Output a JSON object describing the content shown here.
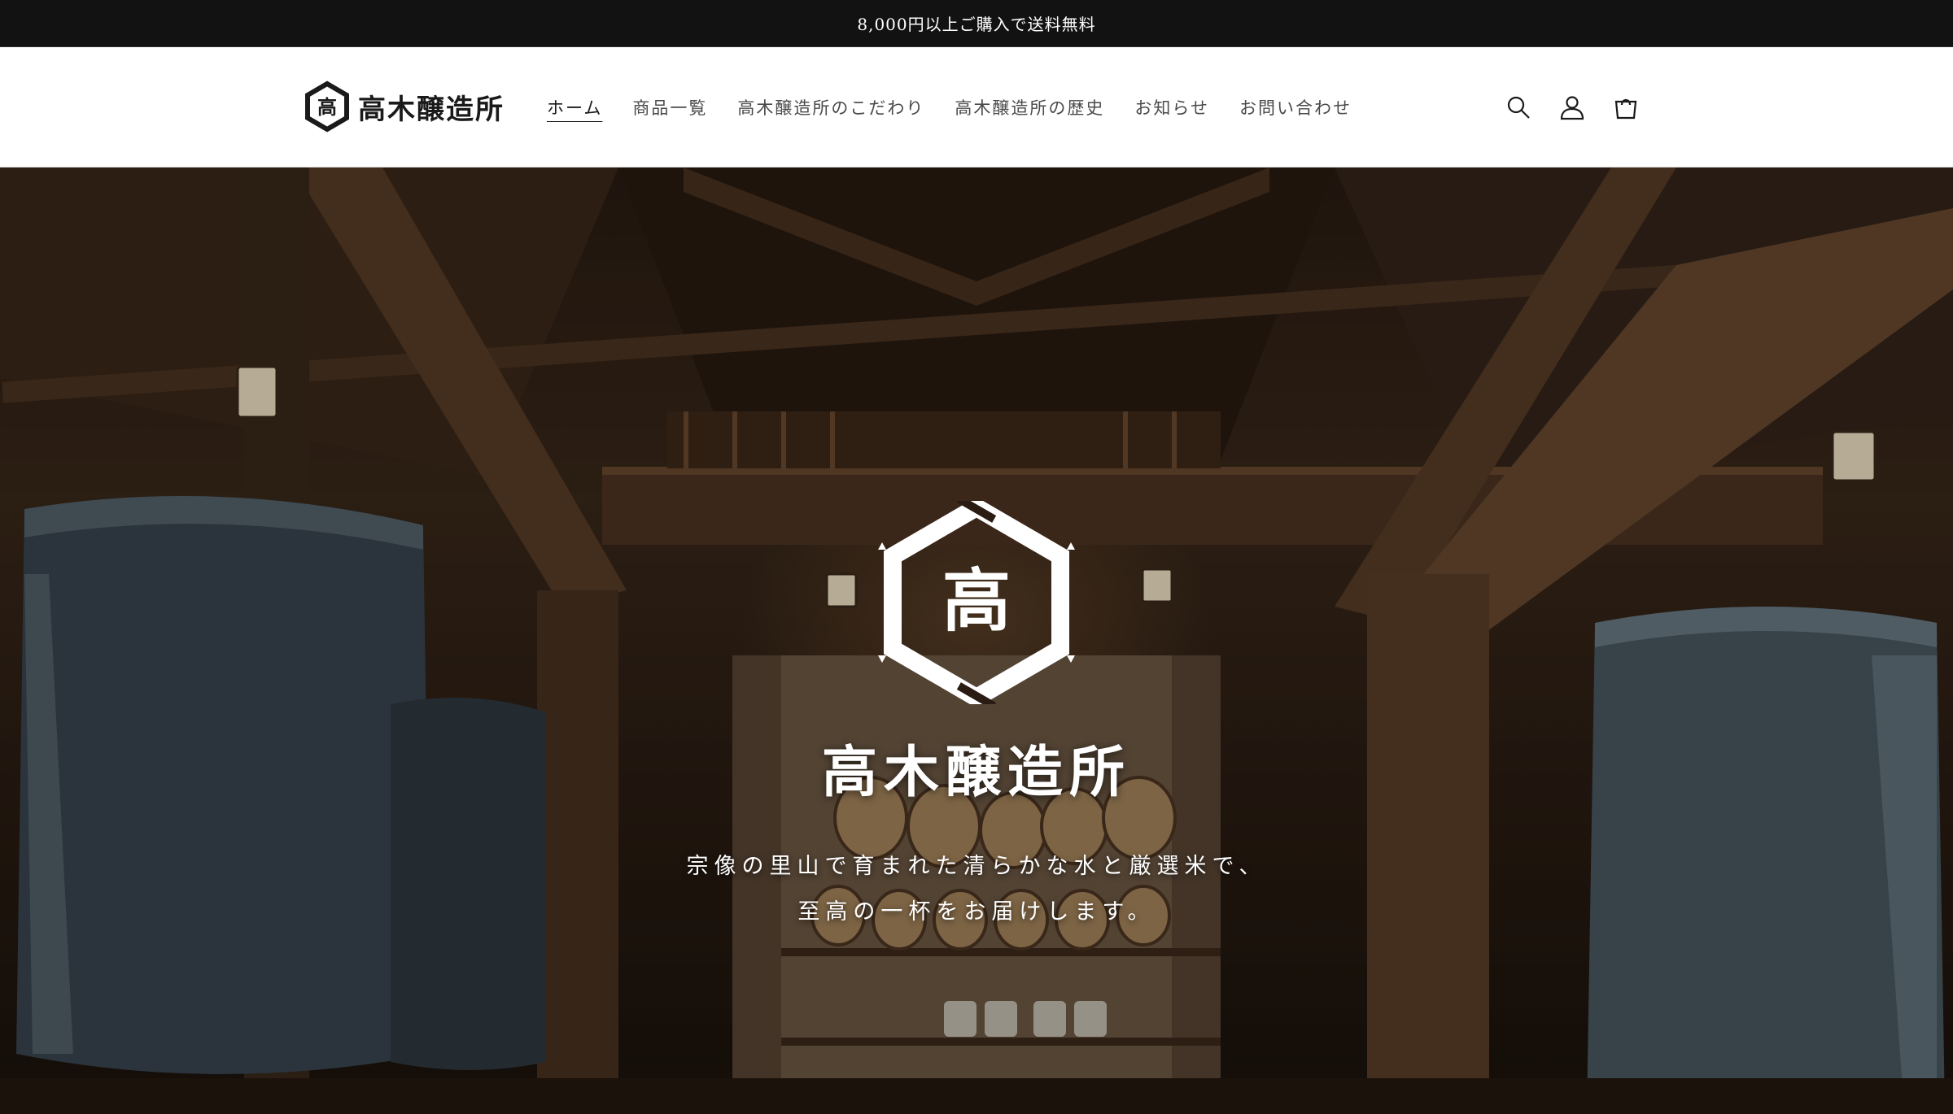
{
  "announcement": {
    "text": "8,000円以上ご購入で送料無料"
  },
  "header": {
    "logo_text": "高木醸造所",
    "logo_glyph": "高",
    "nav": [
      {
        "label": "ホーム",
        "active": true
      },
      {
        "label": "商品一覧",
        "active": false
      },
      {
        "label": "高木醸造所のこだわり",
        "active": false
      },
      {
        "label": "高木醸造所の歴史",
        "active": false
      },
      {
        "label": "お知らせ",
        "active": false
      },
      {
        "label": "お問い合わせ",
        "active": false
      }
    ],
    "icons": [
      "search-icon",
      "account-icon",
      "cart-icon"
    ]
  },
  "hero": {
    "mark_glyph": "高",
    "title": "高木醸造所",
    "tagline_line1": "宗像の里山で育まれた清らかな水と厳選米で、",
    "tagline_line2": "至高の一杯をお届けします。"
  },
  "colors": {
    "announcement_bg": "#121212",
    "header_bg": "#ffffff",
    "text_dark": "#1a1a1a",
    "hero_wood": "#3a281a"
  }
}
